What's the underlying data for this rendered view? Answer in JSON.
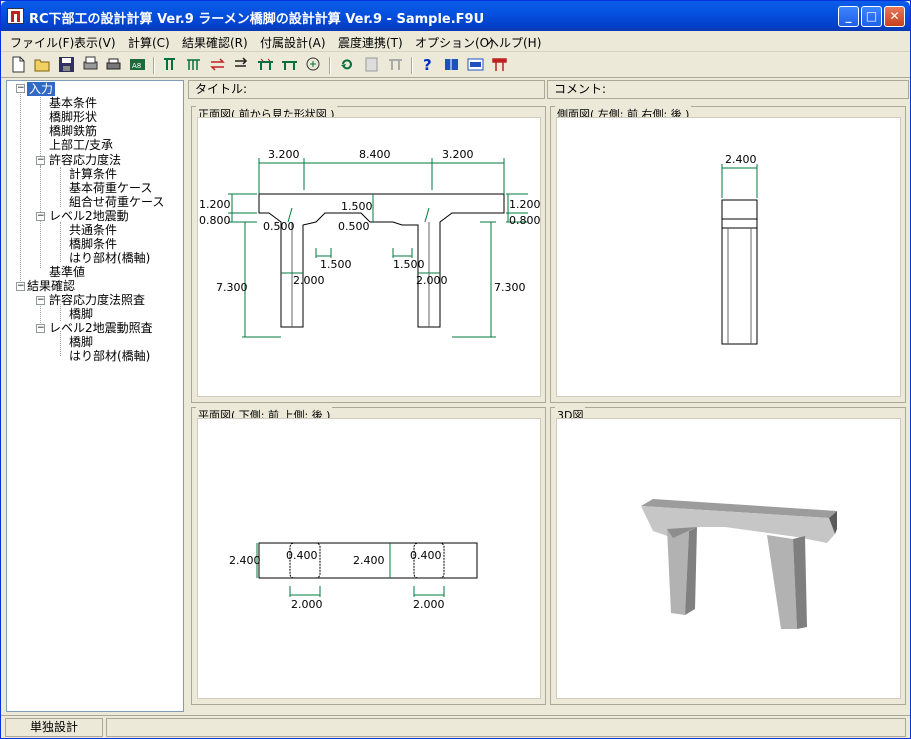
{
  "window": {
    "title": "RC下部工の設計計算 Ver.9 ラーメン橋脚の設計計算 Ver.9 - Sample.F9U",
    "min_label": "_",
    "max_label": "□",
    "close_label": "✕"
  },
  "menu": [
    "ファイル(F)",
    "表示(V)",
    "計算(C)",
    "結果確認(R)",
    "付属設計(A)",
    "震度連携(T)",
    "オプション(O)",
    "ヘルプ(H)"
  ],
  "tree": [
    "入力",
    "基本条件",
    "橋脚形状",
    "橋脚鉄筋",
    "上部工/支承",
    "許容応力度法",
    "計算条件",
    "基本荷重ケース",
    "組合せ荷重ケース",
    "レベル2地震動",
    "共通条件",
    "橋脚条件",
    "はり部材(橋軸)",
    "基準値",
    "結果確認",
    "許容応力度法照査",
    "橋脚",
    "レベル2地震動照査",
    "橋脚",
    "はり部材(橋軸)"
  ],
  "headers": {
    "title_label": "タイトル:",
    "comment_label": "コメント:"
  },
  "panels": {
    "front": "正面図( 前から見た形状図 )",
    "side": "側面図( 左側: 前 右側: 後 )",
    "plan": "平面図( 下側: 前 上側: 後 )",
    "view3d": "3D図"
  },
  "front_dims": {
    "top_left": "3.200",
    "top_mid": "8.400",
    "top_right": "3.200",
    "h1_left": "1.200",
    "h2_left": "0.800",
    "h1_right": "1.200",
    "h2_right": "0.800",
    "hau_mid": "1.500",
    "hau_l": "0.500",
    "hau_r": "0.500",
    "w_l": "1.500",
    "w_r": "1.500",
    "col_l": "2.000",
    "col_r": "2.000",
    "ht_l": "7.300",
    "ht_r": "7.300"
  },
  "side_dims": {
    "width": "2.400"
  },
  "plan_dims": {
    "w_left": "2.400",
    "w_mid": "2.400",
    "c_l": "0.400",
    "c_r": "0.400",
    "b_l": "2.000",
    "b_r": "2.000"
  },
  "status": {
    "mode": "単独設計"
  },
  "colors": {
    "dim": "#007a3d",
    "accent": "#0551e0"
  }
}
